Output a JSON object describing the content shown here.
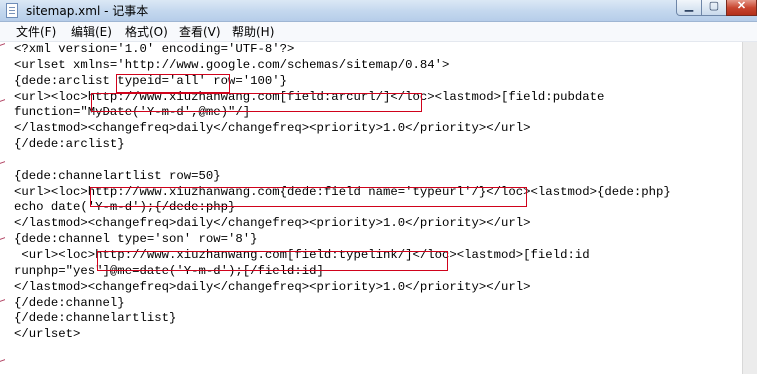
{
  "window": {
    "title": "sitemap.xml - 记事本",
    "minimize_glyph": "▁",
    "maximize_glyph": "▢",
    "close_glyph": "✕"
  },
  "menu": [
    {
      "label": "文件(F)"
    },
    {
      "label": "编辑(E)"
    },
    {
      "label": "格式(O)"
    },
    {
      "label": "查看(V)"
    },
    {
      "label": "帮助(H)"
    }
  ],
  "editor": {
    "lines": [
      "<?xml version='1.0' encoding='UTF-8'?>",
      "<urlset xmlns='http://www.google.com/schemas/sitemap/0.84'>",
      "{dede:arclist typeid='all' row='100'}",
      "<url><loc>http://www.xiuzhanwang.com[field:arcurl/]</loc><lastmod>[field:pubdate",
      "function=\"MyDate('Y-m-d',@me)\"/]",
      "</lastmod><changefreq>daily</changefreq><priority>1.0</priority></url>",
      "{/dede:arclist}",
      "",
      "{dede:channelartlist row=50}",
      "<url><loc>http://www.xiuzhanwang.com{dede:field name='typeurl'/}</loc><lastmod>{dede:php}",
      "echo date('Y-m-d');{/dede:php}",
      "</lastmod><changefreq>daily</changefreq><priority>1.0</priority></url>",
      "{dede:channel type='son' row='8'}",
      " <url><loc>http://www.xiuzhanwang.com[field:typelink/]</loc><lastmod>[field:id",
      "runphp=\"yes\"]@me=date('Y-m-d');[/field:id]",
      "</lastmod><changefreq>daily</changefreq><priority>1.0</priority></url>",
      "{/dede:channel}",
      "{/dede:channelartlist}",
      "</urlset>"
    ]
  }
}
